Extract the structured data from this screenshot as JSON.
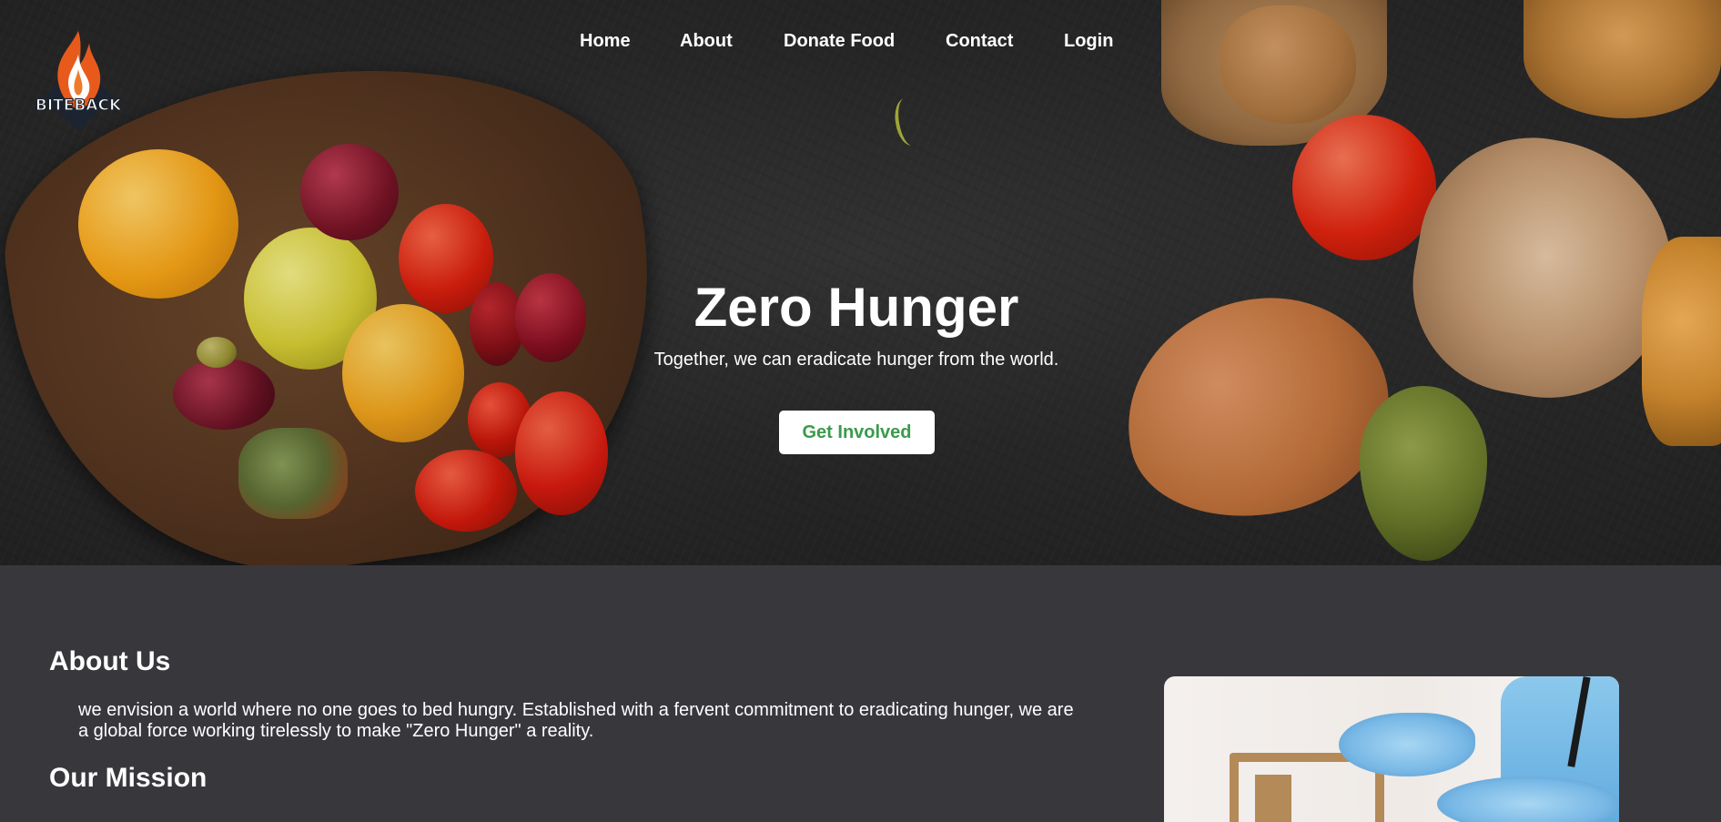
{
  "brand": {
    "logo_text": "BITEBACK"
  },
  "nav": {
    "items": [
      {
        "label": "Home"
      },
      {
        "label": "About"
      },
      {
        "label": "Donate Food"
      },
      {
        "label": "Contact"
      },
      {
        "label": "Login"
      }
    ]
  },
  "hero": {
    "title": "Zero Hunger",
    "subtitle": "Together, we can eradicate hunger from the world.",
    "cta_label": "Get Involved"
  },
  "about": {
    "heading": "About Us",
    "text": "we envision a world where no one goes to bed hungry. Established with a fervent commitment to eradicating hunger, we are a global force working tirelessly to make \"Zero Hunger\" a reality.",
    "mission_heading": "Our Mission"
  },
  "colors": {
    "page_background": "#38373c",
    "cta_text": "#3a9a4c",
    "logo_orange": "#e85a1c",
    "logo_dark": "#1b2430"
  }
}
